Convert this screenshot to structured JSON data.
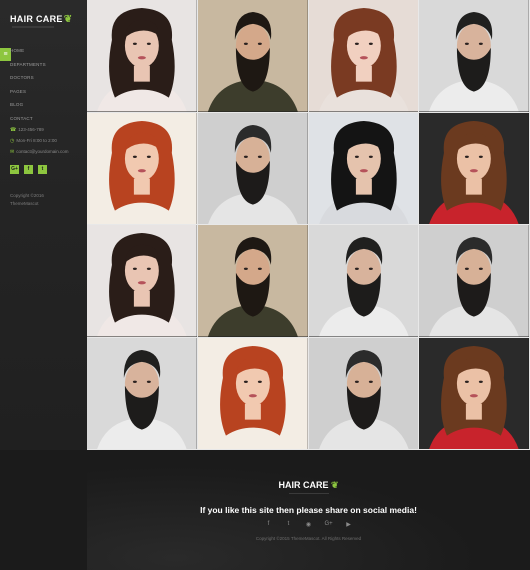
{
  "brand": {
    "logo_text": "HAIR CARE",
    "logo_glyph": "❦"
  },
  "sidebar": {
    "menu_toggle_icon": "≡",
    "nav": [
      "HOME",
      "DEPARTMENTS",
      "DOCTORS",
      "PAGES",
      "BLOG",
      "CONTACT"
    ],
    "contact": [
      {
        "icon": "phone-icon",
        "glyph": "☎",
        "text": "123-456-789"
      },
      {
        "icon": "clock-icon",
        "glyph": "◷",
        "text": "Mon-Fri 8:00 to 2:00"
      },
      {
        "icon": "mail-icon",
        "glyph": "✉",
        "text": "contact@yourdomain.com"
      }
    ],
    "social": [
      {
        "icon": "google-plus-icon",
        "glyph": "G+"
      },
      {
        "icon": "facebook-icon",
        "glyph": "f"
      },
      {
        "icon": "twitter-icon",
        "glyph": "t"
      }
    ],
    "copyright_line1": "Copyright ©2016",
    "copyright_line2": "ThemeMascot"
  },
  "gallery": {
    "tiles": [
      {
        "desc": "woman-dark-wavy-hair",
        "bg": "#e8e4e3",
        "hair": "#2a1d18",
        "skin": "#e9c5b3",
        "beard": "",
        "cloth": "#f0e8e6"
      },
      {
        "desc": "man-beard-tan-background",
        "bg": "#c8b8a0",
        "hair": "#1e1813",
        "skin": "#d4a88a",
        "beard": "#1e1813",
        "cloth": "#3d3d2c"
      },
      {
        "desc": "woman-red-straight-hair",
        "bg": "#e6dcd6",
        "hair": "#7a3a22",
        "skin": "#f1d0c0",
        "beard": "",
        "cloth": "#e9e1dc"
      },
      {
        "desc": "man-beard-side-profile",
        "bg": "#d9d9d9",
        "hair": "#20201f",
        "skin": "#d8b39c",
        "beard": "#1d1c1b",
        "cloth": "#ececec"
      },
      {
        "desc": "woman-red-curly-hair",
        "bg": "#f3ede4",
        "hair": "#b84320",
        "skin": "#f1c9b0",
        "beard": "",
        "cloth": "#f3ede4"
      },
      {
        "desc": "man-beard-comb",
        "bg": "#cfcfcf",
        "hair": "#2b2b2b",
        "skin": "#d7b197",
        "beard": "#1d1b1a",
        "cloth": "#e5e5e5"
      },
      {
        "desc": "woman-black-curly-hair",
        "bg": "#dfe2e6",
        "hair": "#141414",
        "skin": "#e5c3ad",
        "beard": "",
        "cloth": "#d8dade"
      },
      {
        "desc": "woman-brown-curly-hair-red-top",
        "bg": "#2a2a2a",
        "hair": "#6b3a1f",
        "skin": "#ebc1a6",
        "beard": "",
        "cloth": "#c8232c"
      },
      {
        "desc": "woman-dark-wavy-hair",
        "bg": "#e8e4e3",
        "hair": "#2a1d18",
        "skin": "#e9c5b3",
        "beard": "",
        "cloth": "#f0e8e6"
      },
      {
        "desc": "man-beard-tan-background",
        "bg": "#c8b8a0",
        "hair": "#1e1813",
        "skin": "#d4a88a",
        "beard": "#1e1813",
        "cloth": "#3d3d2c"
      },
      {
        "desc": "man-beard-side-profile",
        "bg": "#d9d9d9",
        "hair": "#20201f",
        "skin": "#d8b39c",
        "beard": "#1d1c1b",
        "cloth": "#ececec"
      },
      {
        "desc": "man-beard-comb",
        "bg": "#cfcfcf",
        "hair": "#2b2b2b",
        "skin": "#d7b197",
        "beard": "#1d1b1a",
        "cloth": "#e5e5e5"
      },
      {
        "desc": "man-beard-side-profile",
        "bg": "#d9d9d9",
        "hair": "#20201f",
        "skin": "#d8b39c",
        "beard": "#1d1c1b",
        "cloth": "#ececec"
      },
      {
        "desc": "woman-red-curly-hair",
        "bg": "#f3ede4",
        "hair": "#b84320",
        "skin": "#f1c9b0",
        "beard": "",
        "cloth": "#f3ede4"
      },
      {
        "desc": "man-beard-comb",
        "bg": "#cfcfcf",
        "hair": "#2b2b2b",
        "skin": "#d7b197",
        "beard": "#1d1b1a",
        "cloth": "#e5e5e5"
      },
      {
        "desc": "woman-brown-curly-hair-red-top",
        "bg": "#2a2a2a",
        "hair": "#6b3a1f",
        "skin": "#ebc1a6",
        "beard": "",
        "cloth": "#c8232c"
      }
    ]
  },
  "footer": {
    "logo_text": "HAIR CARE",
    "share_text": "If you like this site then please share on social media!",
    "social": [
      {
        "icon": "facebook-icon",
        "glyph": "f"
      },
      {
        "icon": "twitter-icon",
        "glyph": "t"
      },
      {
        "icon": "dribbble-icon",
        "glyph": "◉"
      },
      {
        "icon": "google-plus-icon",
        "glyph": "G+"
      },
      {
        "icon": "youtube-icon",
        "glyph": "▶"
      }
    ],
    "copyright": "Copyright ©2015 ThemeMascot. All Rights Reserved"
  },
  "colors": {
    "accent": "#8dc63f",
    "background": "#1b1b1b",
    "sidebar": "#242424"
  }
}
